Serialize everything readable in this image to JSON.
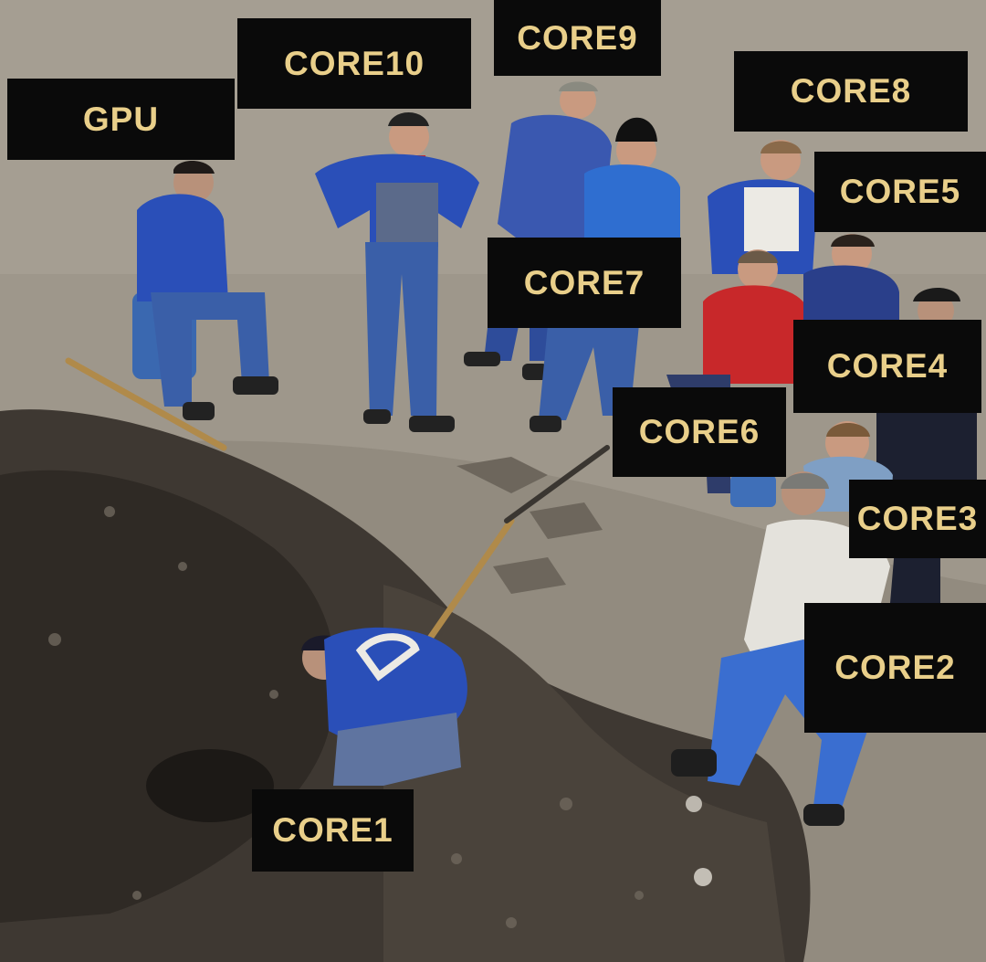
{
  "labels": {
    "gpu": "GPU",
    "core10": "CORE10",
    "core9": "CORE9",
    "core8": "CORE8",
    "core5": "CORE5",
    "core7": "CORE7",
    "core4": "CORE4",
    "core6": "CORE6",
    "core3": "CORE3",
    "core2": "CORE2",
    "core1": "CORE1"
  },
  "colors": {
    "label_background": "#0a0a0a",
    "label_text": "#e9cf8a",
    "workwear_blue": "#2a4fb8",
    "jacket_red": "#c8282a",
    "soil_dark": "#3a342e",
    "ground_gravel": "#9b958a"
  }
}
